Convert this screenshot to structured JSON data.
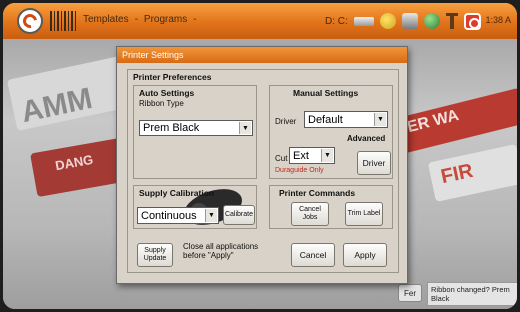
{
  "topbar": {
    "breadcrumb": [
      "Templates",
      "-",
      "Programs",
      "-"
    ],
    "tray_text": "D: C:",
    "clock": "1:38 A"
  },
  "background": {
    "sign_left": "AMM",
    "sign_left_red": "DANG",
    "sign_right": "ER WA",
    "sign_right2": "FIR"
  },
  "dialog": {
    "title": "Printer Settings",
    "prefs_label": "Printer Preferences",
    "auto": {
      "label": "Auto Settings",
      "ribbon_type_label": "Ribbon Type",
      "ribbon_value": "Prem Black"
    },
    "manual": {
      "label": "Manual Settings",
      "driver_label": "Driver",
      "driver_value": "Default",
      "advanced": "Advanced",
      "cut_label": "Cut",
      "cut_value": "Ext",
      "duraguide": "Duraguide Only",
      "driver_button": "Driver"
    },
    "supply": {
      "label": "Supply Calibration",
      "value": "Continuous",
      "calibrate_button": "Calibrate"
    },
    "commands": {
      "label": "Printer Commands",
      "cancel_jobs": "Cancel Jobs",
      "trim_label": "Trim Label"
    },
    "bottom": {
      "supply_update": "Supply Update",
      "close_note": "Close all applications before \"Apply\"",
      "cancel": "Cancel",
      "apply": "Apply"
    }
  },
  "status": {
    "box": "Fer",
    "message": "Ribbon changed? Prem Black"
  }
}
